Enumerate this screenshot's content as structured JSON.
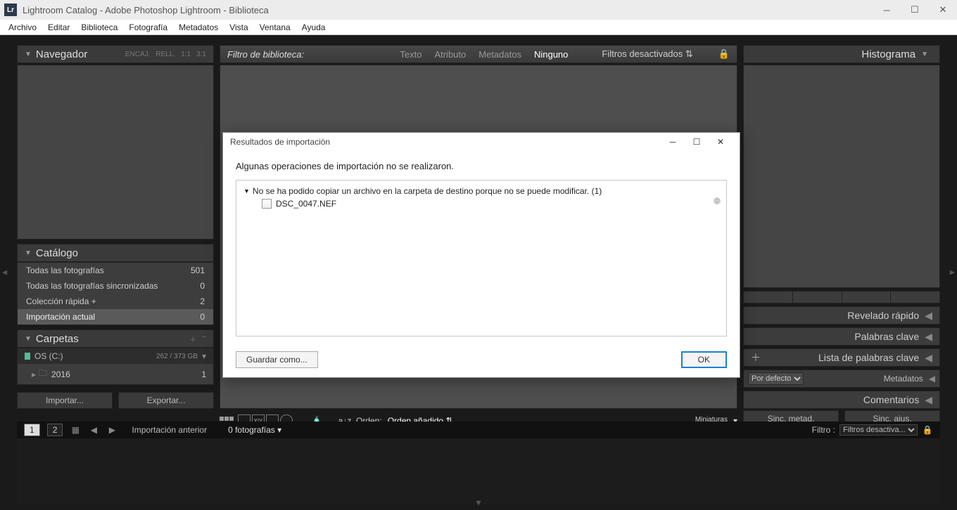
{
  "window": {
    "title": "Lightroom Catalog - Adobe Photoshop Lightroom - Biblioteca"
  },
  "menu": [
    "Archivo",
    "Editar",
    "Biblioteca",
    "Fotografía",
    "Metadatos",
    "Vista",
    "Ventana",
    "Ayuda"
  ],
  "left": {
    "navigator": {
      "title": "Navegador",
      "fit": "ENCAJ.",
      "fill": "RELL.",
      "r11": "1:1",
      "r31": "3:1"
    },
    "catalog": {
      "title": "Catálogo",
      "rows": [
        {
          "label": "Todas las fotografías",
          "count": "501"
        },
        {
          "label": "Todas las fotografías sincronizadas",
          "count": "0"
        },
        {
          "label": "Colección rápida  +",
          "count": "2"
        },
        {
          "label": "Importación actual",
          "count": "0",
          "selected": true
        }
      ]
    },
    "folders": {
      "title": "Carpetas",
      "drive": {
        "name": "OS (C:)",
        "usage": "262 / 373 GB"
      },
      "rows": [
        {
          "name": "2016",
          "count": "1"
        }
      ]
    },
    "import_btn": "Importar...",
    "export_btn": "Exportar..."
  },
  "center": {
    "filter_title": "Filtro de biblioteca:",
    "filters": [
      "Texto",
      "Atributo",
      "Metadatos",
      "Ninguno"
    ],
    "filter_active_index": 3,
    "filters_off": "Filtros desactivados",
    "toolbar": {
      "order_label": "Orden:",
      "order_value": "Orden añadido",
      "thumbs_label": "Miniaturas"
    }
  },
  "right": {
    "histogram": "Histograma",
    "panels": [
      "Revelado rápido",
      "Palabras clave",
      "Lista de palabras clave"
    ],
    "metadata": {
      "title": "Metadatos",
      "preset": "Por defecto"
    },
    "comments": "Comentarios",
    "sync_meta": "Sinc. metad.",
    "sync_adj": "Sinc. ajus."
  },
  "status": {
    "prev_import": "Importación anterior",
    "count_label": "0 fotografías",
    "filter_label": "Filtro :",
    "filter_value": "Filtros desactiva..."
  },
  "dialog": {
    "title": "Resultados de importación",
    "message": "Algunas operaciones de importación no se realizaron.",
    "error_line": "No se ha podido copiar un archivo en la carpeta de destino porque no se puede modificar. (1)",
    "file": "DSC_0047.NEF",
    "save_as": "Guardar como...",
    "ok": "OK"
  }
}
